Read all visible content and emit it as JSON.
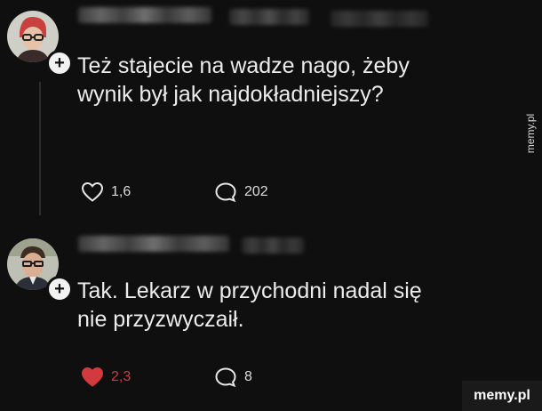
{
  "posts": [
    {
      "text": "Też stajecie na wadze nago, żeby\nwynik był jak najdokładniejszy?",
      "likes": "1,6",
      "replies": "202",
      "liked": false
    },
    {
      "text": "Tak. Lekarz w przychodni nadal się\nnie przyzwyczaił.",
      "likes": "2,3",
      "replies": "8",
      "liked": true
    }
  ],
  "follow_symbol": "+",
  "icons": {
    "like": "heart-icon",
    "liked": "heart-filled-icon",
    "reply": "speech-bubble-icon"
  },
  "colors": {
    "background": "#0f0f0f",
    "liked": "#d23a3e"
  },
  "watermark": {
    "side": "memy.pl",
    "badge": "memy.pl"
  }
}
